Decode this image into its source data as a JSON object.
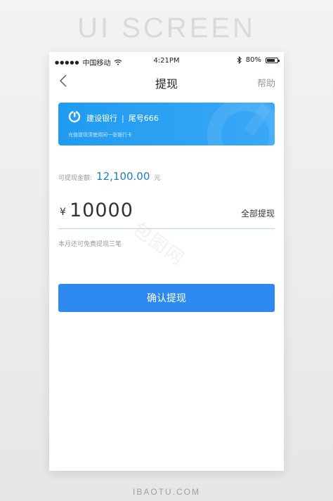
{
  "poster": {
    "title": "UI SCREEN",
    "footer": "IBAOTU.COM"
  },
  "status_bar": {
    "carrier": "中国移动",
    "time": "4:21PM",
    "battery": "80%",
    "battery_level": 0.8,
    "icons": [
      "signal-dots-icon",
      "wifi-icon",
      "bluetooth-icon",
      "battery-icon"
    ]
  },
  "nav": {
    "back_icon": "chevron-left-icon",
    "title": "提现",
    "help": "帮助"
  },
  "bank_card": {
    "logo_icon": "ccb-logo-icon",
    "bank_name": "建设银行",
    "divider": "|",
    "card_tail": "尾号666",
    "hint": "充值提现须使用同一张银行卡",
    "colors": {
      "start": "#1f9bf0",
      "end": "#3aa8f6"
    }
  },
  "balance": {
    "label": "可提现金额:",
    "amount": "12,100.00",
    "unit": "元"
  },
  "amount_input": {
    "currency": "¥",
    "value": "10000",
    "withdraw_all": "全部提现"
  },
  "free_hint": "本月还可免费提现三笔",
  "confirm_button": {
    "label": "确认提现",
    "color": "#2d89f0"
  },
  "watermark": "包图网"
}
